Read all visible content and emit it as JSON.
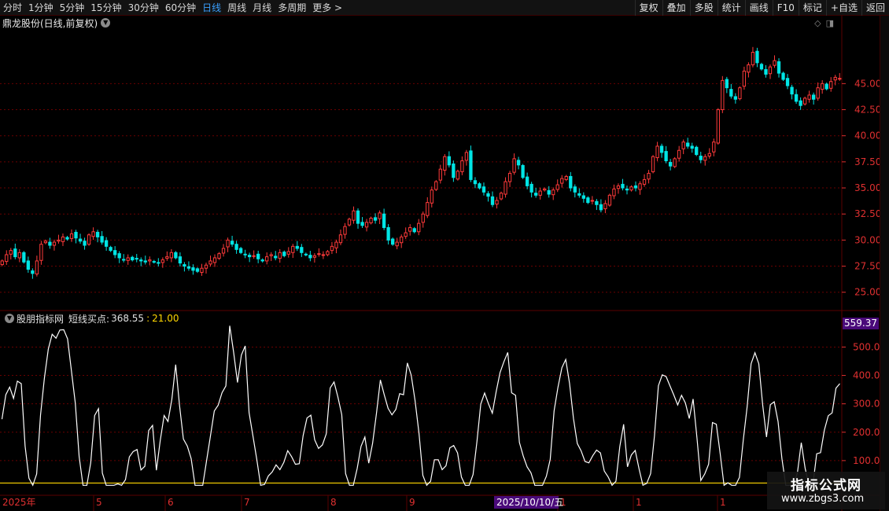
{
  "toolbar": {
    "periods": [
      "分时",
      "1分钟",
      "5分钟",
      "15分钟",
      "30分钟",
      "60分钟",
      "日线",
      "周线",
      "月线",
      "多周期",
      "更多"
    ],
    "active_period": "日线",
    "right_tools": [
      "复权",
      "叠加",
      "多股",
      "统计",
      "画线",
      "F10",
      "标记",
      "+自选",
      "返回"
    ]
  },
  "title": "鼎龙股份(日线,前复权)",
  "main_axis_labels": [
    "45.00",
    "42.50",
    "40.00",
    "37.50",
    "35.00",
    "32.50",
    "30.00",
    "27.50",
    "25.00"
  ],
  "indicator": {
    "name": "股朋指标网",
    "label": "短线买点:",
    "value": "368.55",
    "value2": "21.00",
    "max_label": "559.37",
    "axis_labels": [
      "500.0",
      "400.0",
      "300.0",
      "200.0",
      "100.0"
    ]
  },
  "date_labels": {
    "year": "2025年",
    "months": [
      "5",
      "6",
      "7",
      "8",
      "9",
      "1",
      "1",
      "1"
    ],
    "cursor_date": "2025/10/10/五"
  },
  "watermark": {
    "title": "指标公式网",
    "url": "www.zbgs3.com"
  },
  "colors": {
    "up": "#ff3a3a",
    "down": "#00e5e5",
    "grid": "#6a0000",
    "axis_text": "#e03030",
    "active": "#3aa0ff",
    "yellow": "#ffd700",
    "max_label_bg": "#4a0a7a"
  },
  "chart_data": {
    "type": "candlestick",
    "price_axis": {
      "ymin": 24.0,
      "ymax": 50.0,
      "ticks": [
        25.0,
        27.5,
        30.0,
        32.5,
        35.0,
        37.5,
        40.0,
        42.5,
        45.0
      ]
    },
    "indicator_axis": {
      "ymin": 0,
      "ymax": 559.37,
      "ticks": [
        100,
        200,
        300,
        400,
        500
      ],
      "baseline": 21.0
    },
    "closes": [
      28.0,
      28.6,
      29.0,
      28.4,
      28.8,
      27.9,
      27.2,
      26.8,
      28.0,
      29.6,
      29.9,
      29.5,
      29.8,
      30.0,
      30.3,
      30.1,
      30.6,
      30.2,
      29.9,
      29.5,
      30.5,
      30.8,
      30.3,
      29.8,
      29.4,
      29.0,
      28.6,
      28.3,
      28.1,
      28.3,
      28.1,
      28.2,
      28.0,
      27.9,
      28.1,
      27.9,
      27.8,
      28.1,
      28.4,
      28.8,
      28.3,
      27.8,
      27.5,
      27.3,
      27.1,
      27.0,
      27.3,
      27.6,
      28.0,
      28.3,
      28.7,
      29.2,
      30.0,
      29.6,
      29.1,
      28.8,
      28.6,
      28.4,
      28.5,
      28.2,
      28.0,
      28.4,
      28.6,
      28.3,
      28.8,
      28.5,
      28.9,
      29.4,
      29.2,
      28.8,
      28.6,
      28.3,
      28.5,
      28.7,
      28.6,
      28.9,
      29.4,
      29.8,
      30.5,
      31.3,
      32.0,
      32.8,
      31.6,
      31.4,
      31.7,
      32.1,
      31.9,
      32.6,
      31.2,
      30.0,
      29.6,
      29.8,
      30.3,
      30.7,
      31.2,
      30.8,
      31.6,
      32.5,
      33.6,
      34.8,
      35.6,
      36.8,
      38.0,
      37.2,
      36.0,
      36.6,
      37.6,
      38.4,
      35.8,
      35.4,
      35.0,
      34.6,
      34.2,
      33.4,
      33.8,
      34.5,
      35.6,
      36.4,
      37.8,
      37.2,
      36.0,
      35.2,
      34.6,
      34.3,
      34.7,
      34.9,
      34.4,
      34.8,
      35.3,
      35.9,
      36.1,
      35.0,
      34.6,
      34.3,
      34.0,
      33.6,
      33.8,
      33.4,
      32.9,
      33.5,
      34.3,
      34.9,
      35.2,
      35.0,
      34.8,
      35.1,
      35.0,
      35.4,
      35.8,
      36.4,
      38.0,
      39.0,
      38.4,
      37.6,
      37.1,
      37.8,
      38.6,
      39.4,
      39.0,
      38.8,
      38.2,
      37.7,
      38.0,
      38.3,
      39.4,
      42.5,
      45.3,
      44.6,
      43.8,
      43.5,
      44.6,
      46.2,
      46.8,
      48.0,
      47.0,
      46.4,
      45.9,
      46.6,
      47.2,
      46.0,
      45.4,
      44.8,
      44.0,
      43.3,
      42.9,
      43.6,
      43.9,
      43.5,
      44.6,
      45.0,
      44.5,
      45.2,
      45.6,
      45.5
    ],
    "indicator_values": [
      246,
      332,
      359,
      319,
      380,
      371,
      151,
      38,
      13,
      53,
      260,
      390,
      493,
      545,
      531,
      560,
      561,
      529,
      416,
      303,
      114,
      13,
      13,
      92,
      259,
      283,
      56,
      13,
      13,
      13,
      18,
      13,
      33,
      113,
      132,
      139,
      67,
      80,
      206,
      224,
      66,
      171,
      259,
      238,
      315,
      438,
      294,
      176,
      151,
      107,
      13,
      13,
      13,
      100,
      187,
      275,
      295,
      339,
      363,
      575,
      483,
      375,
      472,
      504,
      269,
      187,
      104,
      13,
      16,
      46,
      60,
      85,
      68,
      94,
      135,
      114,
      87,
      89,
      188,
      250,
      260,
      173,
      143,
      155,
      194,
      356,
      377,
      324,
      262,
      54,
      13,
      13,
      72,
      150,
      183,
      91,
      161,
      268,
      384,
      332,
      284,
      261,
      280,
      336,
      332,
      444,
      401,
      311,
      198,
      48,
      13,
      27,
      103,
      103,
      68,
      82,
      145,
      153,
      127,
      42,
      13,
      13,
      51,
      166,
      299,
      338,
      300,
      267,
      343,
      410,
      448,
      481,
      339,
      330,
      164,
      116,
      78,
      57,
      13,
      13,
      13,
      45,
      105,
      275,
      358,
      427,
      456,
      371,
      249,
      160,
      134,
      97,
      92,
      117,
      137,
      127,
      63,
      42,
      13,
      27,
      149,
      228,
      78,
      120,
      136,
      71,
      13,
      20,
      54,
      188,
      364,
      402,
      396,
      363,
      331,
      296,
      330,
      303,
      248,
      317,
      180,
      30,
      53,
      87,
      234,
      228,
      125,
      13,
      22,
      13,
      13,
      41,
      173,
      290,
      441,
      480,
      441,
      297,
      183,
      297,
      307,
      237,
      107,
      13,
      13,
      13,
      57,
      163,
      73,
      13,
      13,
      124,
      128,
      208,
      258,
      268,
      355,
      371
    ]
  }
}
